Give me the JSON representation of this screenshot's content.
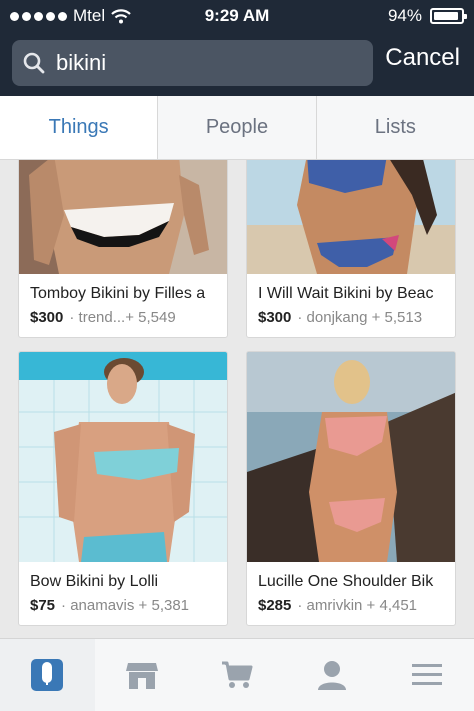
{
  "status": {
    "carrier": "Mtel",
    "time": "9:29 AM",
    "battery": "94%",
    "battery_level": 0.94
  },
  "search": {
    "value": "bikini",
    "cancel_label": "Cancel"
  },
  "tabs": [
    {
      "label": "Things",
      "active": true
    },
    {
      "label": "People",
      "active": false
    },
    {
      "label": "Lists",
      "active": false
    }
  ],
  "products": [
    {
      "title": "Tomboy Bikini by Filles a",
      "price": "$300",
      "meta": "· trend...+ 5,549"
    },
    {
      "title": "I Will Wait Bikini by Beac",
      "price": "$300",
      "meta": "· donjkang + 5,513"
    },
    {
      "title": "Bow Bikini by Lolli",
      "price": "$75",
      "meta": "· anamavis + 5,381"
    },
    {
      "title": "Lucille One Shoulder Bik",
      "price": "$285",
      "meta": "· amrivkin + 4,451"
    }
  ],
  "bottom_nav": [
    {
      "icon": "home-icon",
      "active": true
    },
    {
      "icon": "shop-icon",
      "active": false
    },
    {
      "icon": "cart-icon",
      "active": false
    },
    {
      "icon": "profile-icon",
      "active": false
    },
    {
      "icon": "menu-icon",
      "active": false
    }
  ],
  "colors": {
    "topbar": "#1f2937",
    "accent": "#3a78b6"
  }
}
